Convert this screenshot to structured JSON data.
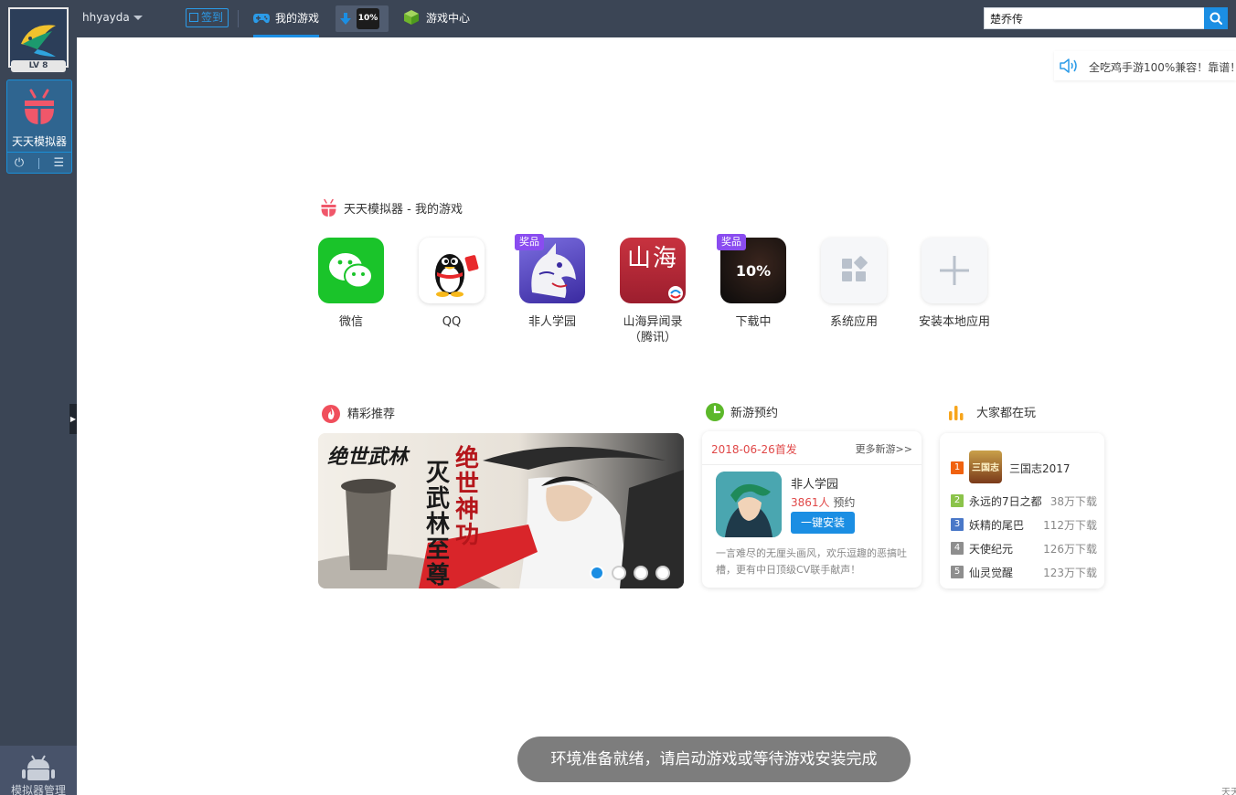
{
  "sidebar": {
    "level": "LV 8",
    "emulator_label": "天天模拟器",
    "manage_label": "模拟器管理"
  },
  "topbar": {
    "username": "hhyayda",
    "checkin_label": "签到",
    "tab_mygames": "我的游戏",
    "download_progress": "10%",
    "tab_center": "游戏中心",
    "search_value": "楚乔传"
  },
  "notice": {
    "text": "全吃鸡手游100%兼容！靠谱！"
  },
  "mygames": {
    "title": "天天模拟器 - 我的游戏",
    "apps": [
      {
        "name": "微信"
      },
      {
        "name": "QQ"
      },
      {
        "name": "非人学园",
        "badge": "奖品"
      },
      {
        "name_line1": "山海异闻录",
        "name_line2": "（腾讯）",
        "tile_text": "山海"
      },
      {
        "name": "下载中",
        "badge": "奖品",
        "progress": "10%"
      },
      {
        "name": "系统应用"
      },
      {
        "name": "安装本地应用"
      }
    ]
  },
  "featured": {
    "title": "精彩推荐",
    "banner_text_1": "绝世神功",
    "banner_text_2": "灭武林至尊",
    "banner_logo": "绝世武林"
  },
  "newgames": {
    "title": "新游预约",
    "date": "2018-06-26首发",
    "more": "更多新游>>",
    "game_name": "非人学园",
    "count": "3861人",
    "count_suffix": " 预约",
    "install_label": "一键安装",
    "description": "一言难尽的无厘头画风，欢乐逗趣的恶搞吐槽，更有中日顶级CV联手献声！"
  },
  "popular": {
    "title": "大家都在玩",
    "items": [
      {
        "rank": "1",
        "name": "三国志2017",
        "downloads": "",
        "color": "#f0620f"
      },
      {
        "rank": "2",
        "name": "永远的7日之都",
        "downloads": "38万下载",
        "color": "#8bc34a"
      },
      {
        "rank": "3",
        "name": "妖精的尾巴",
        "downloads": "112万下载",
        "color": "#4a78c8"
      },
      {
        "rank": "4",
        "name": "天使纪元",
        "downloads": "126万下载",
        "color": "#8e8e8e"
      },
      {
        "rank": "5",
        "name": "仙灵觉醒",
        "downloads": "123万下载",
        "color": "#8e8e8e"
      }
    ],
    "thumb_text": "三国志"
  },
  "toast": {
    "text": "环境准备就绪，请启动游戏或等待游戏安装完成"
  },
  "corner": {
    "text": "天天"
  },
  "colors": {
    "accent": "#1b8ee3",
    "sidebar": "#3b4555",
    "red": "#e04848",
    "prize": "#8a4cf0"
  }
}
